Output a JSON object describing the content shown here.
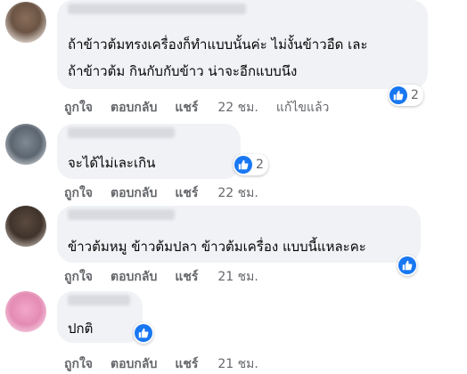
{
  "comments": [
    {
      "lines": [
        "ถ้าข้าวต้มทรงเครื่องก็ทำแบบนั้นค่ะ ไม่งั้นข้าวอืด เละ",
        "ถ้าข้าวต้ม กินกับกับข้าว น่าจะอีกแบบนึง"
      ],
      "reaction_count": "2",
      "like_label": "ถูกใจ",
      "reply_label": "ตอบกลับ",
      "share_label": "แชร์",
      "time": "22 ชม.",
      "edited_label": "แก้ไขแล้ว"
    },
    {
      "lines": [
        "จะได้ไม่เละเกิน"
      ],
      "reaction_count": "2",
      "like_label": "ถูกใจ",
      "reply_label": "ตอบกลับ",
      "share_label": "แชร์",
      "time": "22 ชม."
    },
    {
      "lines": [
        "ข้าวต้มหมู ข้าวต้มปลา ข้าวต้มเครื่อง แบบนี้แหละคะ"
      ],
      "like_label": "ถูกใจ",
      "reply_label": "ตอบกลับ",
      "share_label": "แชร์",
      "time": "21 ชม."
    },
    {
      "lines": [
        "ปกติ"
      ],
      "like_label": "ถูกใจ",
      "reply_label": "ตอบกลับ",
      "share_label": "แชร์",
      "time": "21 ชม."
    }
  ],
  "colors": {
    "bubble_bg": "#f0f2f5",
    "like_blue": "#1877f2",
    "meta_text": "#65676b",
    "body_text": "#050505"
  },
  "icons": {
    "like": "thumbs-up-icon"
  }
}
